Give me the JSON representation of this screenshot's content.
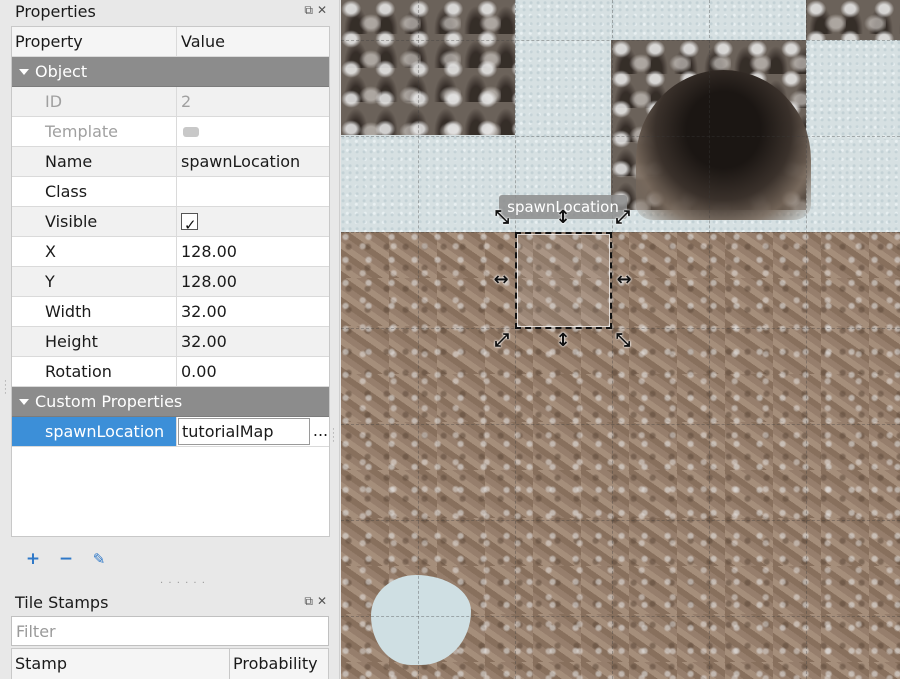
{
  "properties_panel": {
    "title": "Properties",
    "columns": {
      "property": "Property",
      "value": "Value"
    },
    "groups": {
      "object": "Object",
      "custom": "Custom Properties"
    },
    "rows": {
      "id": {
        "label": "ID",
        "value": "2"
      },
      "template": {
        "label": "Template"
      },
      "name": {
        "label": "Name",
        "value": "spawnLocation"
      },
      "class": {
        "label": "Class",
        "value": ""
      },
      "visible": {
        "label": "Visible",
        "checked": true
      },
      "x": {
        "label": "X",
        "value": "128.00"
      },
      "y": {
        "label": "Y",
        "value": "128.00"
      },
      "width": {
        "label": "Width",
        "value": "32.00"
      },
      "height": {
        "label": "Height",
        "value": "32.00"
      },
      "rotation": {
        "label": "Rotation",
        "value": "0.00"
      }
    },
    "custom_property": {
      "name": "spawnLocation",
      "value": "tutorialMap",
      "browse_label": "..."
    },
    "toolbar": {
      "add": "+",
      "remove": "−",
      "rename": "✎"
    }
  },
  "tile_stamps_panel": {
    "title": "Tile Stamps",
    "filter_placeholder": "Filter",
    "columns": {
      "stamp": "Stamp",
      "probability": "Probability"
    }
  },
  "map": {
    "selected_object_label": "spawnLocation"
  },
  "colors": {
    "group_header": "#8c8c8c",
    "selection": "#3c8fd8",
    "panel_bg": "#e8e8e8"
  }
}
